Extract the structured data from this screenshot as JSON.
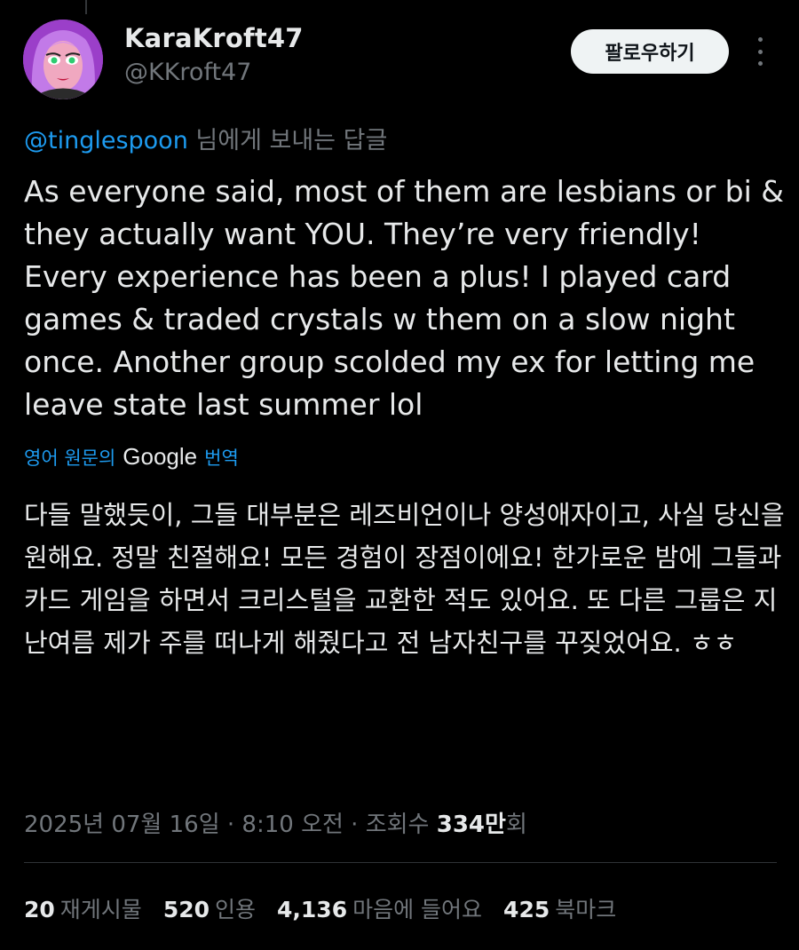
{
  "author": {
    "display_name": "KaraKroft47",
    "handle": "@KKroft47"
  },
  "follow_button_label": "팔로우하기",
  "reply_to": {
    "mention": "@tinglespoon",
    "suffix": " 님에게 보내는 답글"
  },
  "tweet_text": "As everyone said, most of them are lesbians or bi & they actually want YOU. They’re very friendly! Every experience has been a plus! I played card games & traded crystals w them on a slow night once. Another group scolded my ex for letting me leave state last summer lol",
  "translation": {
    "prefix": "영어 원문의",
    "google": "Google",
    "suffix": "번역",
    "text": "다들 말했듯이, 그들 대부분은 레즈비언이나 양성애자이고, 사실 당신을 원해요. 정말 친절해요! 모든 경험이 장점이에요! 한가로운 밤에 그들과 카드 게임을 하면서 크리스털을 교환한 적도 있어요. 또 다른 그룹은 지난여름 제가 주를 떠나게 해줬다고 전 남자친구를 꾸짖었어요. ㅎㅎ"
  },
  "meta": {
    "timestamp": "2025년 07월 16일 · 8:10 오전 · 조회수 ",
    "views_count": "334만",
    "views_suffix": "회"
  },
  "stats": [
    {
      "num": "20",
      "label": "재게시물"
    },
    {
      "num": "520",
      "label": "인용"
    },
    {
      "num": "4,136",
      "label": "마음에 들어요"
    },
    {
      "num": "425",
      "label": "북마크"
    }
  ],
  "colors": {
    "background": "#000000",
    "text": "#e7e9ea",
    "secondary": "#71767b",
    "link": "#1d9bf0"
  },
  "icons": [
    "avatar-image",
    "more-options-icon"
  ]
}
